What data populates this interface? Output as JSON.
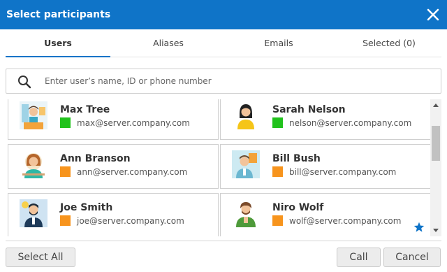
{
  "dialog": {
    "title": "Select participants"
  },
  "tabs": [
    {
      "label": "Users",
      "active": true
    },
    {
      "label": "Aliases",
      "active": false
    },
    {
      "label": "Emails",
      "active": false
    },
    {
      "label": "Selected (0)",
      "active": false
    }
  ],
  "search": {
    "placeholder": "Enter user’s name, ID or phone number",
    "value": ""
  },
  "users": [
    {
      "name": "Max Tree",
      "email": "max@server.company.com",
      "status": "online",
      "status_color": "#21c21c",
      "favorite": false
    },
    {
      "name": "Sarah Nelson",
      "email": "nelson@server.company.com",
      "status": "online",
      "status_color": "#21c21c",
      "favorite": false
    },
    {
      "name": "Ann Branson",
      "email": "ann@server.company.com",
      "status": "away",
      "status_color": "#f7941d",
      "favorite": false
    },
    {
      "name": "Bill Bush",
      "email": "bill@server.company.com",
      "status": "away",
      "status_color": "#f7941d",
      "favorite": false
    },
    {
      "name": "Joe Smith",
      "email": "joe@server.company.com",
      "status": "away",
      "status_color": "#f7941d",
      "favorite": false
    },
    {
      "name": "Niro Wolf",
      "email": "wolf@server.company.com",
      "status": "away",
      "status_color": "#f7941d",
      "favorite": true
    }
  ],
  "buttons": {
    "select_all": "Select All",
    "call": "Call",
    "cancel": "Cancel"
  },
  "colors": {
    "accent": "#0f74c8",
    "online": "#21c21c",
    "away": "#f7941d",
    "favorite": "#0f74c8"
  }
}
